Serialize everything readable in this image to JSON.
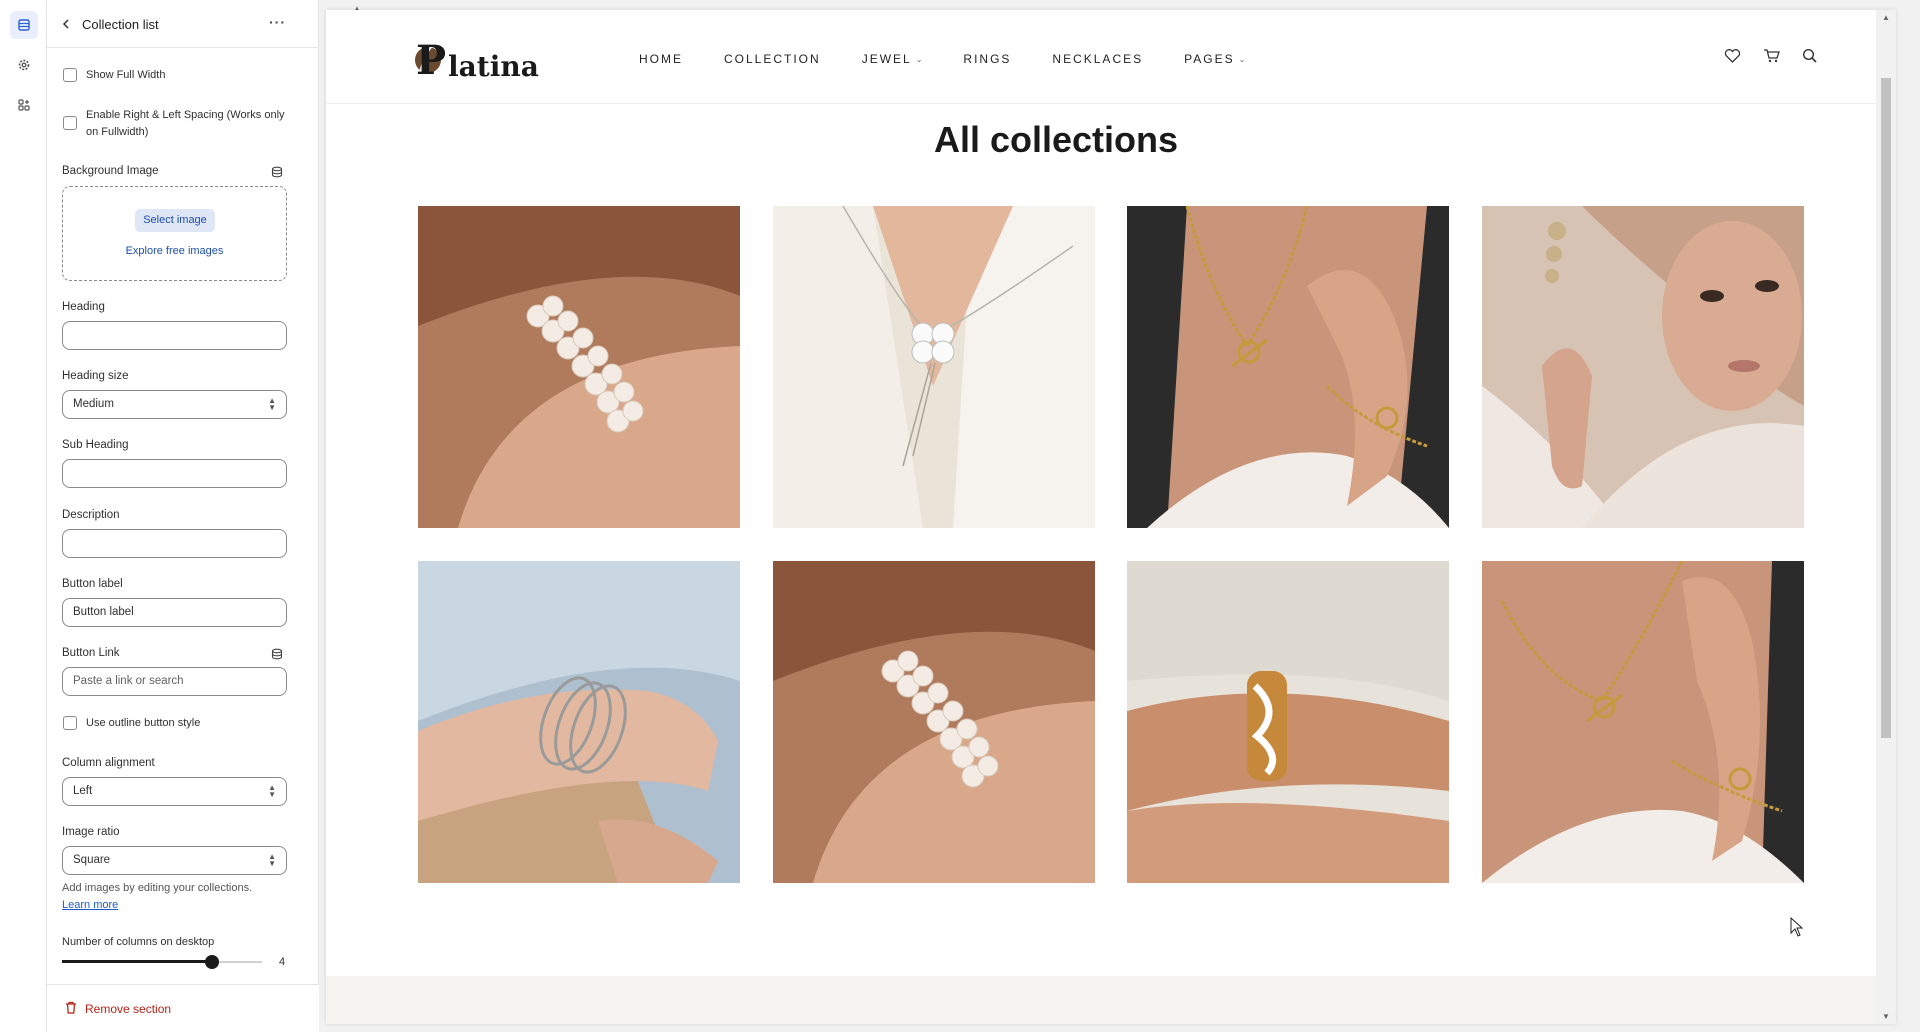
{
  "panel": {
    "title": "Collection list",
    "more": "···",
    "show_full_width": "Show Full Width",
    "enable_spacing": "Enable Right & Left Spacing (Works only on Fullwidth)",
    "background_image": "Background Image",
    "select_image": "Select image",
    "explore_images": "Explore free images",
    "heading_label": "Heading",
    "heading_value": "",
    "heading_size_label": "Heading size",
    "heading_size_value": "Medium",
    "sub_heading_label": "Sub Heading",
    "sub_heading_value": "",
    "description_label": "Description",
    "description_value": "",
    "button_label_label": "Button label",
    "button_label_value": "Button label",
    "button_link_label": "Button Link",
    "button_link_placeholder": "Paste a link or search",
    "outline_style": "Use outline button style",
    "column_alignment_label": "Column alignment",
    "column_alignment_value": "Left",
    "image_ratio_label": "Image ratio",
    "image_ratio_value": "Square",
    "help_text": "Add images by editing your collections.",
    "learn_more": "Learn more",
    "columns_label": "Number of columns on desktop",
    "columns_value": "4",
    "columns_fraction": 0.75,
    "remove_section": "Remove section"
  },
  "site": {
    "logo_text": "latina",
    "logo_initial": "P",
    "nav": [
      {
        "label": "HOME",
        "dropdown": false
      },
      {
        "label": "COLLECTION",
        "dropdown": false
      },
      {
        "label": "JEWEL",
        "dropdown": true
      },
      {
        "label": "RINGS",
        "dropdown": false
      },
      {
        "label": "NECKLACES",
        "dropdown": false
      },
      {
        "label": "PAGES",
        "dropdown": true
      }
    ],
    "page_title": "All collections"
  },
  "colors": {
    "accent": "#1f4fa8",
    "danger": "#b42318"
  },
  "icons": [
    "sections-icon",
    "gear-icon",
    "apps-icon",
    "heart-icon",
    "cart-icon",
    "search-icon"
  ]
}
